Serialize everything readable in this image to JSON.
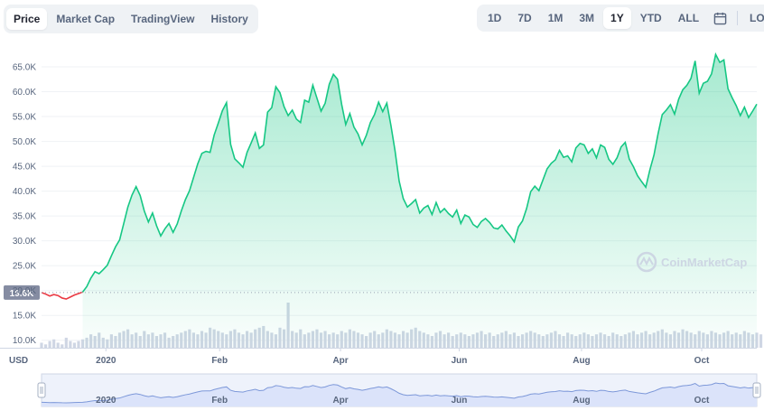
{
  "tabs_left": [
    {
      "label": "Price",
      "active": true
    },
    {
      "label": "Market Cap",
      "active": false
    },
    {
      "label": "TradingView",
      "active": false
    },
    {
      "label": "History",
      "active": false
    }
  ],
  "ranges": [
    {
      "label": "1D",
      "active": false
    },
    {
      "label": "7D",
      "active": false
    },
    {
      "label": "1M",
      "active": false
    },
    {
      "label": "3M",
      "active": false
    },
    {
      "label": "1Y",
      "active": true
    },
    {
      "label": "YTD",
      "active": false
    },
    {
      "label": "ALL",
      "active": false
    }
  ],
  "log_label": "LOG",
  "calendar_icon": "calendar-icon",
  "watermark": "CoinMarketCap",
  "colors": {
    "up": "#16c784",
    "down": "#ea3943",
    "grid": "#eff2f5",
    "volume": "#cfd6e4",
    "navigator_fill": "#dbe3fa",
    "navigator_line": "#7d98d9",
    "baseline_label_bg": "#858ca2"
  },
  "chart_data": {
    "type": "area",
    "currency_label": "USD",
    "y_ticks": [
      "65.0K",
      "60.0K",
      "55.0K",
      "50.0K",
      "45.0K",
      "40.0K",
      "35.0K",
      "30.0K",
      "25.0K",
      "20.0K",
      "15.0K",
      "10.0K"
    ],
    "baseline_label": "19.6K",
    "baseline_value": 19600,
    "x_labels": [
      "2020",
      "Feb",
      "Apr",
      "Jun",
      "Aug",
      "Oct"
    ],
    "nav_x_labels": [
      "2020",
      "Feb",
      "Apr",
      "Jun",
      "Aug",
      "Oct"
    ],
    "ylim": [
      8500,
      69000
    ],
    "series": [
      {
        "values": [
          19600,
          19300,
          18900,
          19200,
          19000,
          18500,
          18300,
          18700,
          19100,
          19400,
          19700,
          20800,
          22500,
          23800,
          23400,
          24200,
          25100,
          27000,
          28800,
          30200,
          33500,
          36800,
          39200,
          40900,
          39100,
          36000,
          33800,
          35600,
          33000,
          31000,
          32400,
          33500,
          31700,
          33400,
          36000,
          38300,
          40100,
          42800,
          45500,
          47600,
          48000,
          47800,
          51300,
          53700,
          56200,
          57800,
          49400,
          46500,
          45700,
          44800,
          47800,
          49700,
          51700,
          48600,
          49300,
          55900,
          56800,
          61000,
          59800,
          57000,
          55200,
          56300,
          54500,
          53800,
          58300,
          57900,
          61300,
          58700,
          56100,
          57700,
          61500,
          63500,
          62500,
          57500,
          53400,
          55600,
          52900,
          51500,
          49300,
          51200,
          53800,
          55400,
          57900,
          56000,
          57700,
          53200,
          48100,
          42000,
          38500,
          36800,
          37500,
          38300,
          35600,
          36600,
          37100,
          35300,
          37700,
          35700,
          36500,
          35500,
          34800,
          36200,
          33500,
          35200,
          34800,
          33300,
          32700,
          33900,
          34500,
          33700,
          32600,
          32400,
          33200,
          32000,
          31000,
          29800,
          32800,
          34000,
          36500,
          39900,
          41000,
          40100,
          42300,
          44500,
          45600,
          46300,
          48200,
          46800,
          47100,
          45900,
          48700,
          49600,
          49300,
          47600,
          48500,
          46700,
          49300,
          48800,
          46400,
          45400,
          46700,
          48900,
          49800,
          46400,
          44900,
          43100,
          41900,
          40800,
          44300,
          47300,
          51600,
          55400,
          56300,
          57400,
          55500,
          58500,
          60400,
          61300,
          62700,
          66200,
          59700,
          61700,
          62100,
          63600,
          67500,
          65900,
          66400,
          60600,
          58800,
          57200,
          55200,
          56900,
          54800,
          56100,
          57500
        ]
      }
    ],
    "volume": [
      3,
      2,
      4,
      5,
      3,
      2,
      6,
      4,
      3,
      4,
      5,
      6,
      8,
      7,
      9,
      6,
      5,
      8,
      7,
      9,
      10,
      11,
      8,
      9,
      7,
      10,
      8,
      9,
      7,
      8,
      9,
      6,
      7,
      8,
      9,
      10,
      11,
      9,
      8,
      10,
      9,
      12,
      11,
      10,
      9,
      8,
      10,
      11,
      9,
      8,
      10,
      9,
      11,
      12,
      13,
      10,
      9,
      8,
      12,
      11,
      27,
      10,
      9,
      11,
      8,
      9,
      10,
      11,
      9,
      10,
      8,
      9,
      8,
      10,
      9,
      11,
      10,
      9,
      8,
      7,
      9,
      10,
      8,
      9,
      11,
      10,
      9,
      8,
      10,
      9,
      11,
      12,
      10,
      9,
      8,
      7,
      9,
      10,
      8,
      9,
      7,
      8,
      9,
      8,
      7,
      8,
      9,
      10,
      8,
      9,
      7,
      8,
      9,
      10,
      8,
      9,
      7,
      8,
      9,
      10,
      9,
      8,
      7,
      8,
      9,
      10,
      8,
      7,
      9,
      8,
      7,
      8,
      9,
      8,
      7,
      8,
      9,
      8,
      7,
      9,
      8,
      7,
      8,
      9,
      10,
      8,
      9,
      10,
      8,
      9,
      10,
      11,
      9,
      8,
      10,
      9,
      11,
      10,
      9,
      8,
      10,
      9,
      8,
      10,
      9,
      8,
      9,
      10,
      8,
      9,
      8,
      10,
      9,
      8,
      9,
      8
    ]
  }
}
